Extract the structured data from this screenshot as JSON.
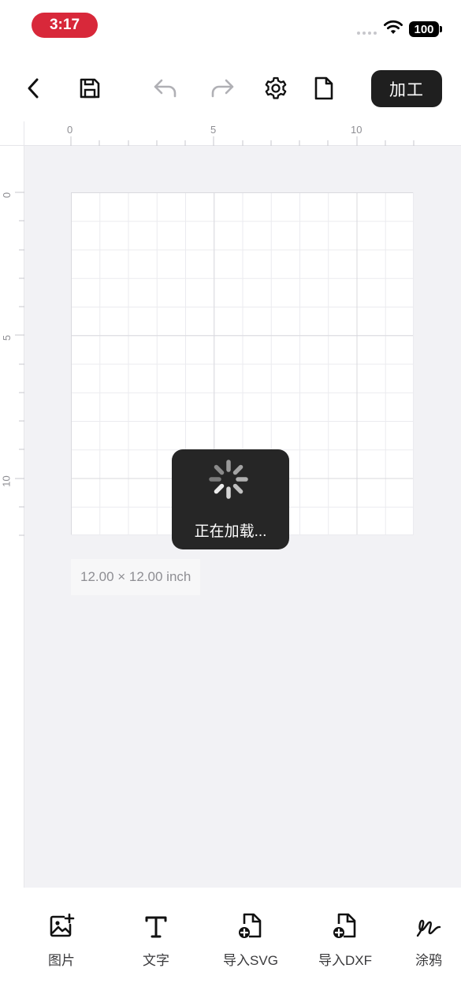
{
  "status_bar": {
    "time": "3:17",
    "battery": "100"
  },
  "toolbar": {
    "back_icon": "chevron-left-icon",
    "save_icon": "save-disk-icon",
    "undo_icon": "undo-icon",
    "redo_icon": "redo-icon",
    "settings_icon": "gear-icon",
    "file_icon": "document-icon",
    "process_label": "加工"
  },
  "ruler": {
    "top_labels": [
      "0",
      "5",
      "10"
    ],
    "left_labels": [
      "0",
      "5",
      "10"
    ]
  },
  "canvas": {
    "size_label": "12.00 × 12.00 inch"
  },
  "loading": {
    "text": "正在加载..."
  },
  "bottom_bar": {
    "items": [
      {
        "label": "图片",
        "icon": "image-add-icon"
      },
      {
        "label": "文字",
        "icon": "text-icon"
      },
      {
        "label": "导入SVG",
        "icon": "import-file-icon"
      },
      {
        "label": "导入DXF",
        "icon": "import-file-icon"
      },
      {
        "label": "涂鸦",
        "icon": "scribble-icon"
      }
    ]
  },
  "colors": {
    "time_pill": "#d8283a",
    "dark": "#1f1f1f",
    "canvas_bg": "#f2f2f5"
  }
}
